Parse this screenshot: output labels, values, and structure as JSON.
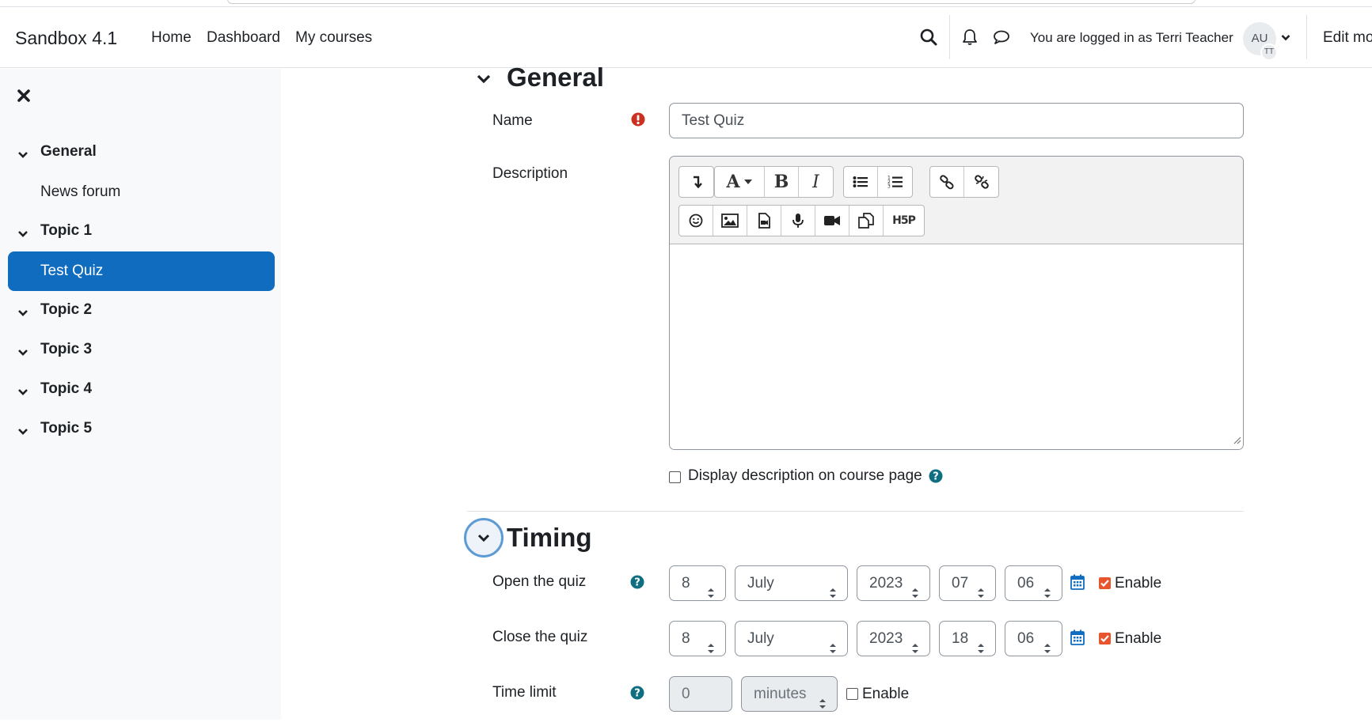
{
  "navbar": {
    "brand": "Sandbox 4.1",
    "links": [
      "Home",
      "Dashboard",
      "My courses"
    ],
    "login_text": "You are logged in as Terri Teacher",
    "avatar_initials": "AU",
    "avatar_sub_initials": "TT",
    "edit_mode_label": "Edit mo"
  },
  "drawer": {
    "sections": [
      {
        "title": "General",
        "items": [
          "News forum"
        ]
      },
      {
        "title": "Topic 1",
        "items": [
          "Test Quiz"
        ]
      },
      {
        "title": "Topic 2",
        "items": []
      },
      {
        "title": "Topic 3",
        "items": []
      },
      {
        "title": "Topic 4",
        "items": []
      },
      {
        "title": "Topic 5",
        "items": []
      }
    ],
    "active_item": "Test Quiz"
  },
  "general": {
    "title": "General",
    "name_label": "Name",
    "name_value": "Test Quiz",
    "description_label": "Description",
    "editor_buttons_row1": [
      "paragraph-toggle",
      "font-style",
      "bold",
      "italic",
      "unordered-list",
      "ordered-list",
      "link",
      "unlink"
    ],
    "editor_buttons_row2": [
      "emoji",
      "image",
      "media",
      "record-audio",
      "record-video",
      "manage-files",
      "h5p"
    ],
    "bold_glyph": "B",
    "italic_glyph": "I",
    "font_glyph": "A",
    "h5p_glyph": "H5P",
    "display_description_label": "Display description on course page"
  },
  "timing": {
    "title": "Timing",
    "open": {
      "label": "Open the quiz",
      "day": "8",
      "month": "July",
      "year": "2023",
      "hour": "07",
      "minute": "06",
      "enable_label": "Enable",
      "enabled": true
    },
    "close": {
      "label": "Close the quiz",
      "day": "8",
      "month": "July",
      "year": "2023",
      "hour": "18",
      "minute": "06",
      "enable_label": "Enable",
      "enabled": true
    },
    "time_limit": {
      "label": "Time limit",
      "value": "0",
      "unit": "minutes",
      "enable_label": "Enable",
      "enabled": false
    }
  },
  "colors": {
    "accent": "#0f6cbf",
    "required": "#ca3120",
    "help": "#0f6f80",
    "checkbox_on": "#e8552c"
  }
}
